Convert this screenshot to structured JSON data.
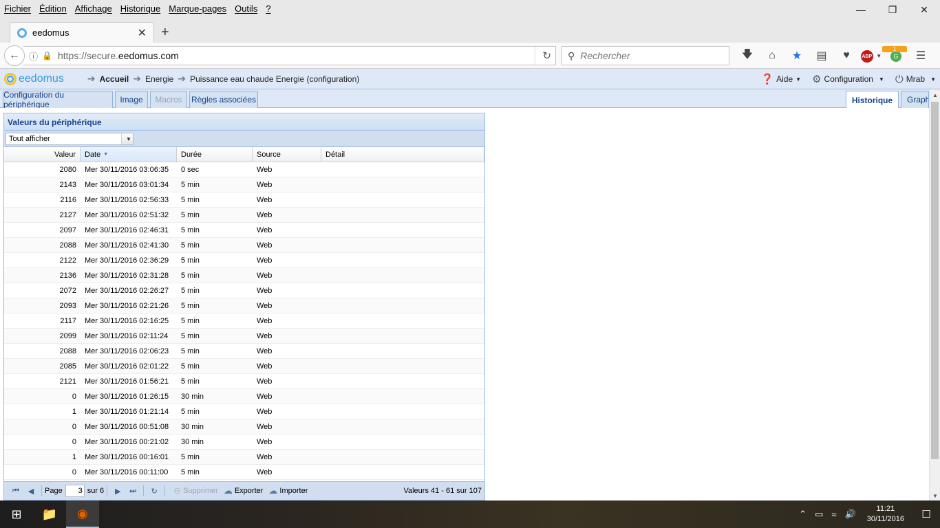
{
  "menubar": {
    "items": [
      "Fichier",
      "Édition",
      "Affichage",
      "Historique",
      "Marque-pages",
      "Outils",
      "?"
    ]
  },
  "browser": {
    "tab_title": "eedomus",
    "url_host_prefix": "https://secure.",
    "url_host_main": "eedomus.com",
    "search_placeholder": "Rechercher",
    "abp_label": "ABP",
    "ext_badge": "1"
  },
  "app": {
    "logo_text": "eedomus",
    "breadcrumb": [
      "Accueil",
      "Energie",
      "Puissance eau chaude Energie (configuration)"
    ],
    "help_label": "Aide",
    "config_label": "Configuration",
    "user_label": "Mrab",
    "tabs_left": [
      "Configuration du périphérique",
      "Image",
      "Macros",
      "Règles associées"
    ],
    "tabs_right": [
      "Historique",
      "Graphe"
    ]
  },
  "panel": {
    "title": "Valeurs du périphérique",
    "filter_value": "Tout afficher",
    "columns": [
      "Valeur",
      "Date",
      "Durée",
      "Source",
      "Détail"
    ],
    "rows": [
      [
        "2080",
        "Mer 30/11/2016 03:06:35",
        "0 sec",
        "Web",
        ""
      ],
      [
        "2143",
        "Mer 30/11/2016 03:01:34",
        "5 min",
        "Web",
        ""
      ],
      [
        "2116",
        "Mer 30/11/2016 02:56:33",
        "5 min",
        "Web",
        ""
      ],
      [
        "2127",
        "Mer 30/11/2016 02:51:32",
        "5 min",
        "Web",
        ""
      ],
      [
        "2097",
        "Mer 30/11/2016 02:46:31",
        "5 min",
        "Web",
        ""
      ],
      [
        "2088",
        "Mer 30/11/2016 02:41:30",
        "5 min",
        "Web",
        ""
      ],
      [
        "2122",
        "Mer 30/11/2016 02:36:29",
        "5 min",
        "Web",
        ""
      ],
      [
        "2136",
        "Mer 30/11/2016 02:31:28",
        "5 min",
        "Web",
        ""
      ],
      [
        "2072",
        "Mer 30/11/2016 02:26:27",
        "5 min",
        "Web",
        ""
      ],
      [
        "2093",
        "Mer 30/11/2016 02:21:26",
        "5 min",
        "Web",
        ""
      ],
      [
        "2117",
        "Mer 30/11/2016 02:16:25",
        "5 min",
        "Web",
        ""
      ],
      [
        "2099",
        "Mer 30/11/2016 02:11:24",
        "5 min",
        "Web",
        ""
      ],
      [
        "2088",
        "Mer 30/11/2016 02:06:23",
        "5 min",
        "Web",
        ""
      ],
      [
        "2085",
        "Mer 30/11/2016 02:01:22",
        "5 min",
        "Web",
        ""
      ],
      [
        "2121",
        "Mer 30/11/2016 01:56:21",
        "5 min",
        "Web",
        ""
      ],
      [
        "0",
        "Mer 30/11/2016 01:26:15",
        "30 min",
        "Web",
        ""
      ],
      [
        "1",
        "Mer 30/11/2016 01:21:14",
        "5 min",
        "Web",
        ""
      ],
      [
        "0",
        "Mer 30/11/2016 00:51:08",
        "30 min",
        "Web",
        ""
      ],
      [
        "0",
        "Mer 30/11/2016 00:21:02",
        "30 min",
        "Web",
        ""
      ],
      [
        "1",
        "Mer 30/11/2016 00:16:01",
        "5 min",
        "Web",
        ""
      ],
      [
        "0",
        "Mer 30/11/2016 00:11:00",
        "5 min",
        "Web",
        ""
      ]
    ],
    "pager": {
      "page_label": "Page",
      "current_page": "3",
      "of_label": "sur 6",
      "delete_label": "Supprimer",
      "export_label": "Exporter",
      "import_label": "Importer",
      "summary": "Valeurs 41 - 61 sur 107"
    }
  },
  "taskbar": {
    "time": "11:21",
    "date": "30/11/2016"
  }
}
